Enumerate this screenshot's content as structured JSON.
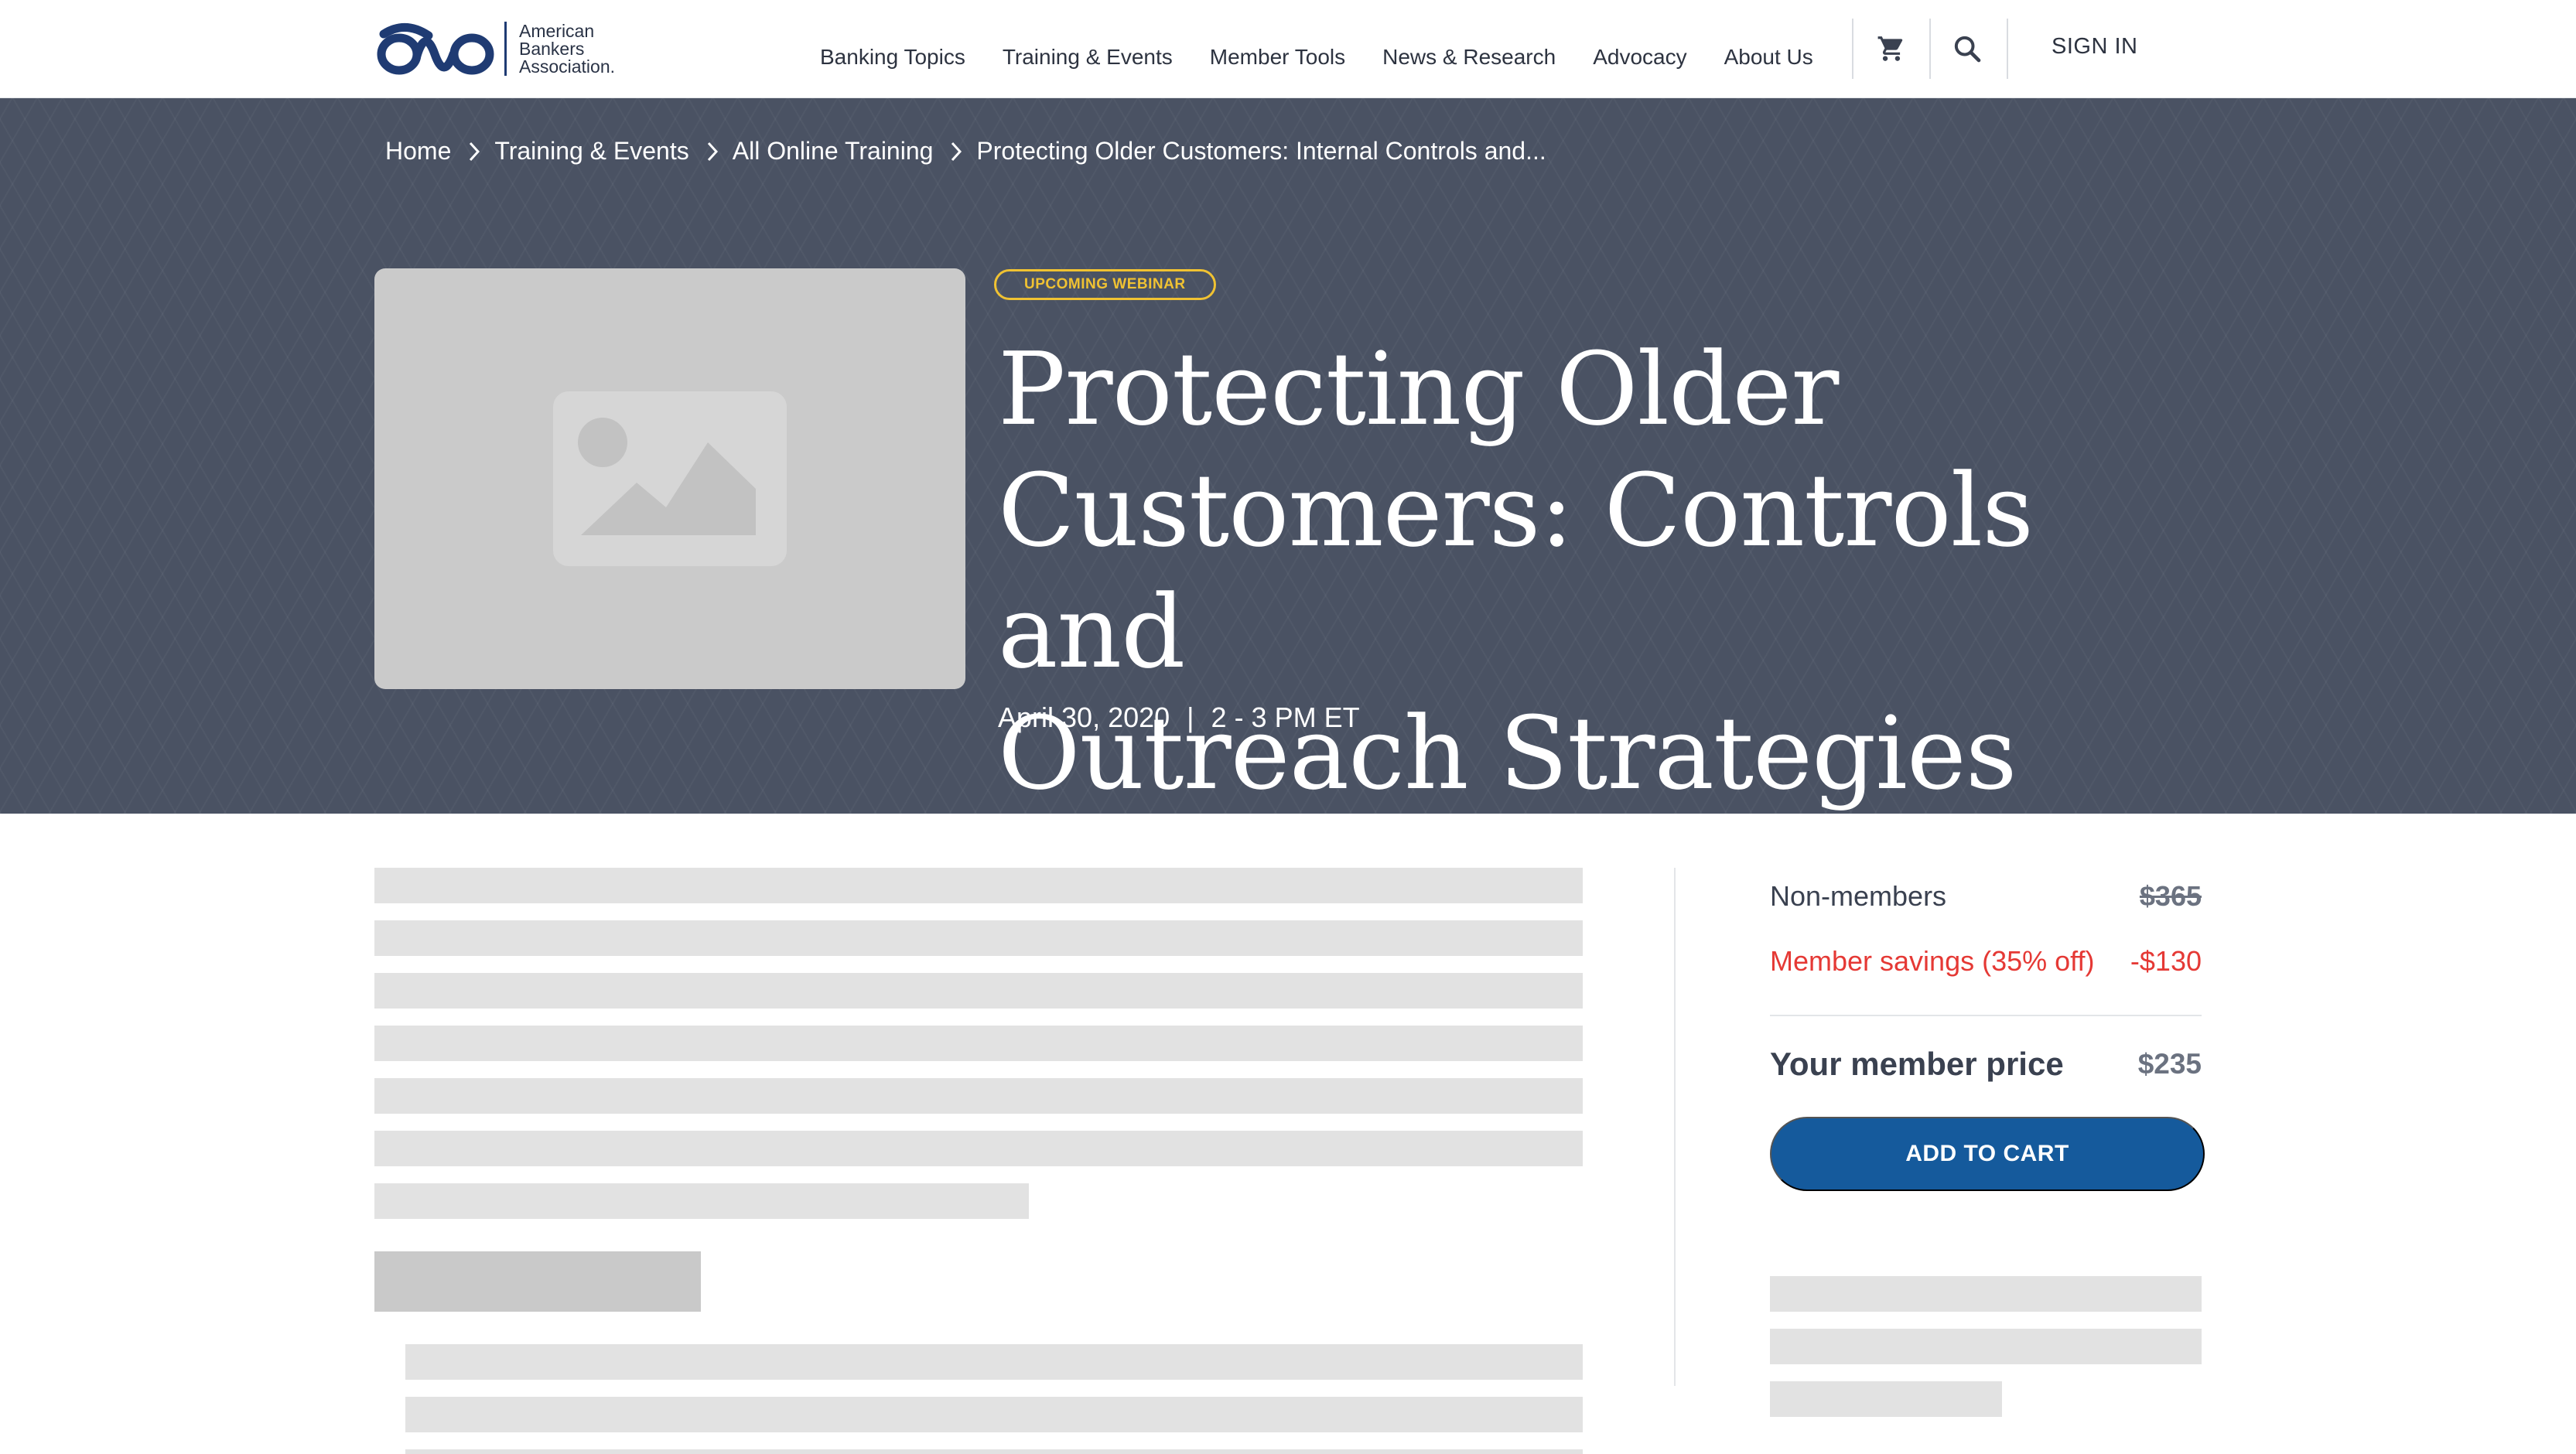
{
  "header": {
    "logo": {
      "line1": "American",
      "line2": "Bankers",
      "line3": "Association.",
      "color": "#1f3b73"
    },
    "nav": [
      {
        "label": "Banking Topics"
      },
      {
        "label": "Training & Events"
      },
      {
        "label": "Member Tools"
      },
      {
        "label": "News & Research"
      },
      {
        "label": "Advocacy"
      },
      {
        "label": "About Us"
      }
    ],
    "icons": {
      "cart": "cart-icon",
      "search": "search-icon"
    },
    "sign_in": "SIGN IN"
  },
  "hero": {
    "background": "#4a5263",
    "breadcrumb": [
      "Home",
      "Training & Events",
      "All Online Training",
      "Protecting Older Customers: Internal Controls and..."
    ],
    "thumbnail_icon": "image-placeholder-icon",
    "badge": "UPCOMING WEBINAR",
    "badge_color": "#f0c232",
    "title_lines": [
      "Protecting Older",
      "Customers: Controls and",
      "Outreach Strategies"
    ],
    "date": "April 30, 2020",
    "separator": "|",
    "time": "2 - 3 PM ET"
  },
  "pricing": {
    "nonmember_label": "Non-members",
    "nonmember_price": "$365",
    "savings_label": "Member savings (35% off)",
    "savings_amount": "-$130",
    "savings_color": "#e53935",
    "member_label": "Your member price",
    "member_price": "$235",
    "cta": "ADD TO CART",
    "cta_color": "#155a9c"
  }
}
